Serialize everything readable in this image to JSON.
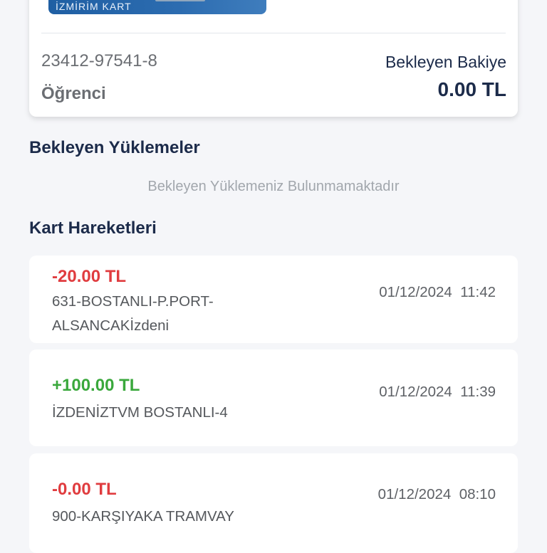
{
  "card": {
    "brand": "İZMİRİM KART",
    "number": "23412-97541-8",
    "type": "Öğrenci",
    "pending_label": "Bekleyen Bakiye",
    "pending_amount": "0.00 TL"
  },
  "pending_section": {
    "title": "Bekleyen Yüklemeler",
    "empty_message": "Bekleyen Yüklemeniz Bulunmamaktadır"
  },
  "transactions_section": {
    "title": "Kart Hareketleri",
    "items": [
      {
        "amount": "-20.00 TL",
        "direction": "debit",
        "description": "631-BOSTANLI-P.PORT-ALSANCAKİzdeni",
        "date": "01/12/2024",
        "time": "11:42"
      },
      {
        "amount": "+100.00 TL",
        "direction": "credit",
        "description": "İZDENİZTVM BOSTANLI-4",
        "date": "01/12/2024",
        "time": "11:39"
      },
      {
        "amount": "-0.00 TL",
        "direction": "debit",
        "description": "900-KARŞIYAKA TRAMVAY",
        "date": "01/12/2024",
        "time": "08:10"
      }
    ]
  },
  "colors": {
    "debit": "#e03c3f",
    "credit": "#3aa83c",
    "heading": "#1c2b4a"
  }
}
